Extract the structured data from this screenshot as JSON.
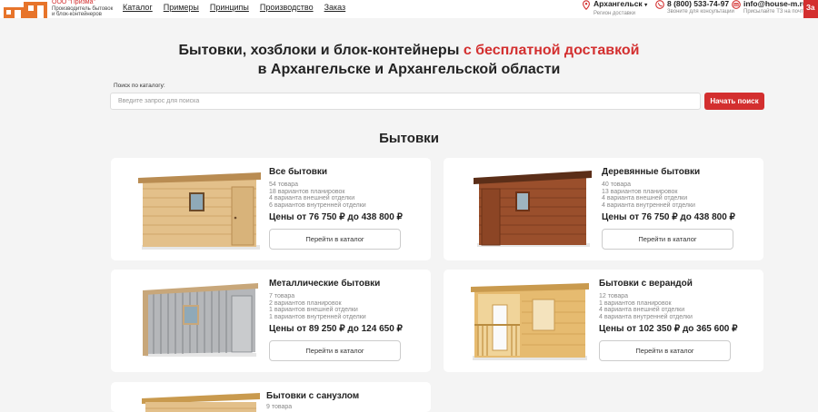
{
  "header": {
    "company": "ООО \"Призма\"",
    "tagline_1": "Производитель бытовок",
    "tagline_2": "и блок-контейнеров",
    "nav": [
      "Каталог",
      "Примеры",
      "Принципы",
      "Производство",
      "Заказ"
    ],
    "region": {
      "value": "Архангельск",
      "label": "Регион доставки"
    },
    "phone": {
      "value": "8 (800) 533-74-97",
      "label": "Звоните для консультации"
    },
    "email": {
      "value": "info@house-m.ru",
      "label": "Присылайте ТЗ на почту"
    },
    "cta": "За"
  },
  "hero": {
    "line1_plain": "Бытовки, хозблоки и блок-контейнеры ",
    "line1_accent": "с бесплатной доставкой",
    "line2": "в Архангельске и Архангельской области"
  },
  "search": {
    "label": "Поиск по каталогу:",
    "placeholder": "Введите запрос для поиска",
    "button": "Начать поиск"
  },
  "section_title": "Бытовки",
  "cards": [
    {
      "title": "Все бытовки",
      "stats": [
        "54 товара",
        "18 вариантов планировок",
        "4 варианта внешней отделки",
        "6 вариантов внутренней отделки"
      ],
      "price": "Цены от 76 750 ₽ до 438 800 ₽",
      "button": "Перейти в каталог"
    },
    {
      "title": "Деревянные бытовки",
      "stats": [
        "40 товара",
        "13 вариантов планировок",
        "4 варианта внешней отделки",
        "4 варианта внутренней отделки"
      ],
      "price": "Цены от 76 750 ₽ до 438 800 ₽",
      "button": "Перейти в каталог"
    },
    {
      "title": "Металлические бытовки",
      "stats": [
        "7 товара",
        "2 вариантов планировок",
        "1 вариантов внешней отделки",
        "1 вариантов внутренней отделки"
      ],
      "price": "Цены от 89 250 ₽ до 124 650 ₽",
      "button": "Перейти в каталог"
    },
    {
      "title": "Бытовки с верандой",
      "stats": [
        "12 товара",
        "1 вариантов планировок",
        "4 варианта внешней отделки",
        "4 варианта внутренней отделки"
      ],
      "price": "Цены от 102 350 ₽ до 365 600 ₽",
      "button": "Перейти в каталог"
    },
    {
      "title": "Бытовки с санузлом",
      "stats": [
        "9 товара"
      ],
      "price": "",
      "button": ""
    }
  ],
  "colors": {
    "accent": "#d32f2f",
    "background": "#f4f4f4"
  }
}
